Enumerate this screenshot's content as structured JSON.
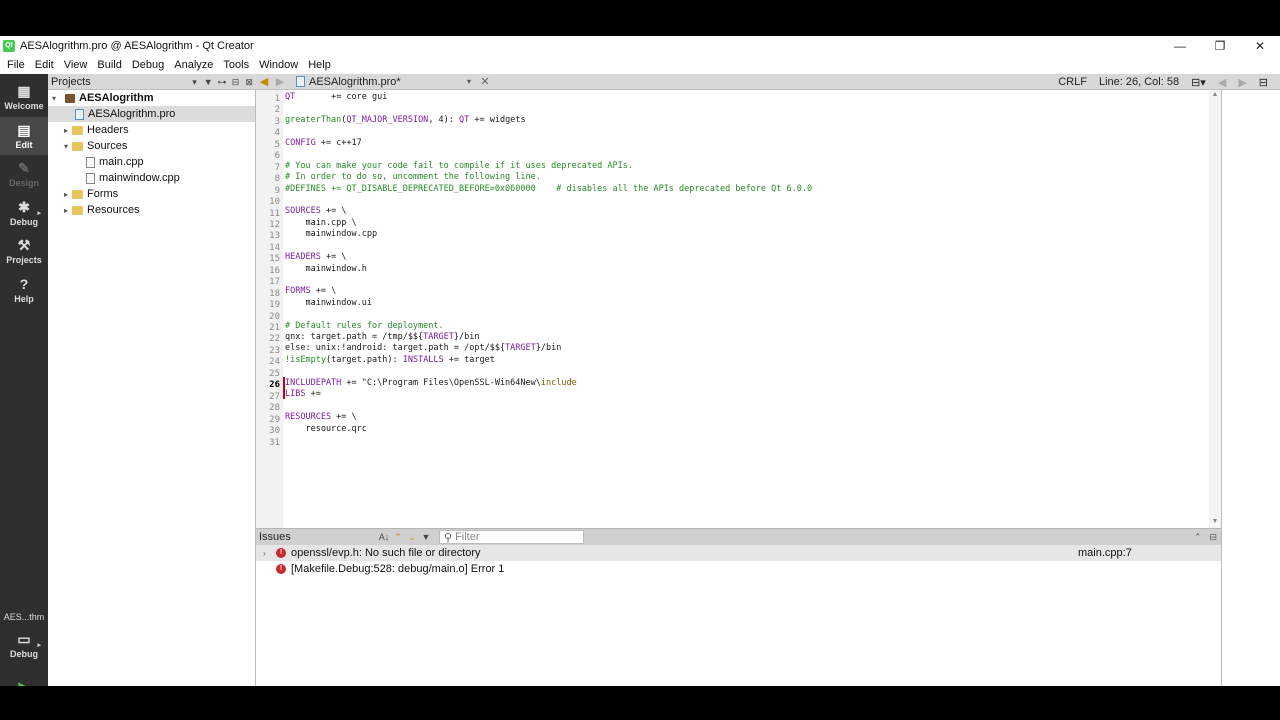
{
  "window": {
    "title": "AESAlogrithm.pro @ AESAlogrithm - Qt Creator",
    "app_icon_text": "Qt",
    "controls": {
      "minimize": "—",
      "maximize": "❐",
      "close": "✕"
    }
  },
  "menu": [
    "File",
    "Edit",
    "View",
    "Build",
    "Debug",
    "Analyze",
    "Tools",
    "Window",
    "Help"
  ],
  "modes": {
    "welcome": "Welcome",
    "edit": "Edit",
    "design": "Design",
    "debug": "Debug",
    "projects": "Projects",
    "help": "Help",
    "kit_label": "AES...thm",
    "kit_mode": "Debug"
  },
  "projects_pane": {
    "title": "Projects",
    "tree": {
      "root": "AESAlogrithm",
      "pro_file": "AESAlogrithm.pro",
      "headers": "Headers",
      "sources": "Sources",
      "main_cpp": "main.cpp",
      "mainwindow_cpp": "mainwindow.cpp",
      "forms": "Forms",
      "resources": "Resources"
    }
  },
  "editor": {
    "open_file": "AESAlogrithm.pro*",
    "line_ending": "CRLF",
    "cursor": "Line: 26, Col: 58",
    "current_line": 26,
    "line_numbers": [
      "1",
      "2",
      "3",
      "4",
      "5",
      "6",
      "7",
      "8",
      "9",
      "10",
      "11",
      "12",
      "13",
      "14",
      "15",
      "16",
      "17",
      "18",
      "19",
      "20",
      "21",
      "22",
      "23",
      "24",
      "25",
      "26",
      "27",
      "28",
      "29",
      "30",
      "31"
    ]
  },
  "issues": {
    "title": "Issues",
    "filter_placeholder": "Filter",
    "items": [
      {
        "message": "openssl/evp.h: No such file or directory",
        "location": "main.cpp:7"
      },
      {
        "message": "[Makefile.Debug:528: debug/main.o] Error 1",
        "location": ""
      }
    ]
  },
  "colors": {
    "modebar_bg": "#2f2f2f",
    "error_red": "#c9282d",
    "keyword": "#7a1f9e",
    "comment": "#2a8a2a",
    "run_green": "#4fc24f"
  }
}
